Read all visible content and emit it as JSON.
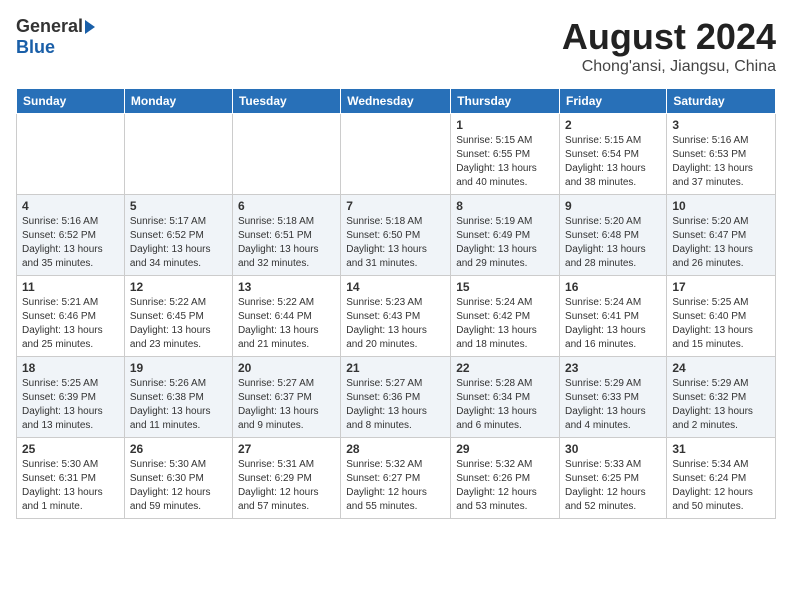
{
  "header": {
    "logo_general": "General",
    "logo_blue": "Blue",
    "title": "August 2024",
    "location": "Chong'ansi, Jiangsu, China"
  },
  "weekdays": [
    "Sunday",
    "Monday",
    "Tuesday",
    "Wednesday",
    "Thursday",
    "Friday",
    "Saturday"
  ],
  "weeks": [
    [
      {
        "day": "",
        "info": ""
      },
      {
        "day": "",
        "info": ""
      },
      {
        "day": "",
        "info": ""
      },
      {
        "day": "",
        "info": ""
      },
      {
        "day": "1",
        "info": "Sunrise: 5:15 AM\nSunset: 6:55 PM\nDaylight: 13 hours\nand 40 minutes."
      },
      {
        "day": "2",
        "info": "Sunrise: 5:15 AM\nSunset: 6:54 PM\nDaylight: 13 hours\nand 38 minutes."
      },
      {
        "day": "3",
        "info": "Sunrise: 5:16 AM\nSunset: 6:53 PM\nDaylight: 13 hours\nand 37 minutes."
      }
    ],
    [
      {
        "day": "4",
        "info": "Sunrise: 5:16 AM\nSunset: 6:52 PM\nDaylight: 13 hours\nand 35 minutes."
      },
      {
        "day": "5",
        "info": "Sunrise: 5:17 AM\nSunset: 6:52 PM\nDaylight: 13 hours\nand 34 minutes."
      },
      {
        "day": "6",
        "info": "Sunrise: 5:18 AM\nSunset: 6:51 PM\nDaylight: 13 hours\nand 32 minutes."
      },
      {
        "day": "7",
        "info": "Sunrise: 5:18 AM\nSunset: 6:50 PM\nDaylight: 13 hours\nand 31 minutes."
      },
      {
        "day": "8",
        "info": "Sunrise: 5:19 AM\nSunset: 6:49 PM\nDaylight: 13 hours\nand 29 minutes."
      },
      {
        "day": "9",
        "info": "Sunrise: 5:20 AM\nSunset: 6:48 PM\nDaylight: 13 hours\nand 28 minutes."
      },
      {
        "day": "10",
        "info": "Sunrise: 5:20 AM\nSunset: 6:47 PM\nDaylight: 13 hours\nand 26 minutes."
      }
    ],
    [
      {
        "day": "11",
        "info": "Sunrise: 5:21 AM\nSunset: 6:46 PM\nDaylight: 13 hours\nand 25 minutes."
      },
      {
        "day": "12",
        "info": "Sunrise: 5:22 AM\nSunset: 6:45 PM\nDaylight: 13 hours\nand 23 minutes."
      },
      {
        "day": "13",
        "info": "Sunrise: 5:22 AM\nSunset: 6:44 PM\nDaylight: 13 hours\nand 21 minutes."
      },
      {
        "day": "14",
        "info": "Sunrise: 5:23 AM\nSunset: 6:43 PM\nDaylight: 13 hours\nand 20 minutes."
      },
      {
        "day": "15",
        "info": "Sunrise: 5:24 AM\nSunset: 6:42 PM\nDaylight: 13 hours\nand 18 minutes."
      },
      {
        "day": "16",
        "info": "Sunrise: 5:24 AM\nSunset: 6:41 PM\nDaylight: 13 hours\nand 16 minutes."
      },
      {
        "day": "17",
        "info": "Sunrise: 5:25 AM\nSunset: 6:40 PM\nDaylight: 13 hours\nand 15 minutes."
      }
    ],
    [
      {
        "day": "18",
        "info": "Sunrise: 5:25 AM\nSunset: 6:39 PM\nDaylight: 13 hours\nand 13 minutes."
      },
      {
        "day": "19",
        "info": "Sunrise: 5:26 AM\nSunset: 6:38 PM\nDaylight: 13 hours\nand 11 minutes."
      },
      {
        "day": "20",
        "info": "Sunrise: 5:27 AM\nSunset: 6:37 PM\nDaylight: 13 hours\nand 9 minutes."
      },
      {
        "day": "21",
        "info": "Sunrise: 5:27 AM\nSunset: 6:36 PM\nDaylight: 13 hours\nand 8 minutes."
      },
      {
        "day": "22",
        "info": "Sunrise: 5:28 AM\nSunset: 6:34 PM\nDaylight: 13 hours\nand 6 minutes."
      },
      {
        "day": "23",
        "info": "Sunrise: 5:29 AM\nSunset: 6:33 PM\nDaylight: 13 hours\nand 4 minutes."
      },
      {
        "day": "24",
        "info": "Sunrise: 5:29 AM\nSunset: 6:32 PM\nDaylight: 13 hours\nand 2 minutes."
      }
    ],
    [
      {
        "day": "25",
        "info": "Sunrise: 5:30 AM\nSunset: 6:31 PM\nDaylight: 13 hours\nand 1 minute."
      },
      {
        "day": "26",
        "info": "Sunrise: 5:30 AM\nSunset: 6:30 PM\nDaylight: 12 hours\nand 59 minutes."
      },
      {
        "day": "27",
        "info": "Sunrise: 5:31 AM\nSunset: 6:29 PM\nDaylight: 12 hours\nand 57 minutes."
      },
      {
        "day": "28",
        "info": "Sunrise: 5:32 AM\nSunset: 6:27 PM\nDaylight: 12 hours\nand 55 minutes."
      },
      {
        "day": "29",
        "info": "Sunrise: 5:32 AM\nSunset: 6:26 PM\nDaylight: 12 hours\nand 53 minutes."
      },
      {
        "day": "30",
        "info": "Sunrise: 5:33 AM\nSunset: 6:25 PM\nDaylight: 12 hours\nand 52 minutes."
      },
      {
        "day": "31",
        "info": "Sunrise: 5:34 AM\nSunset: 6:24 PM\nDaylight: 12 hours\nand 50 minutes."
      }
    ]
  ]
}
